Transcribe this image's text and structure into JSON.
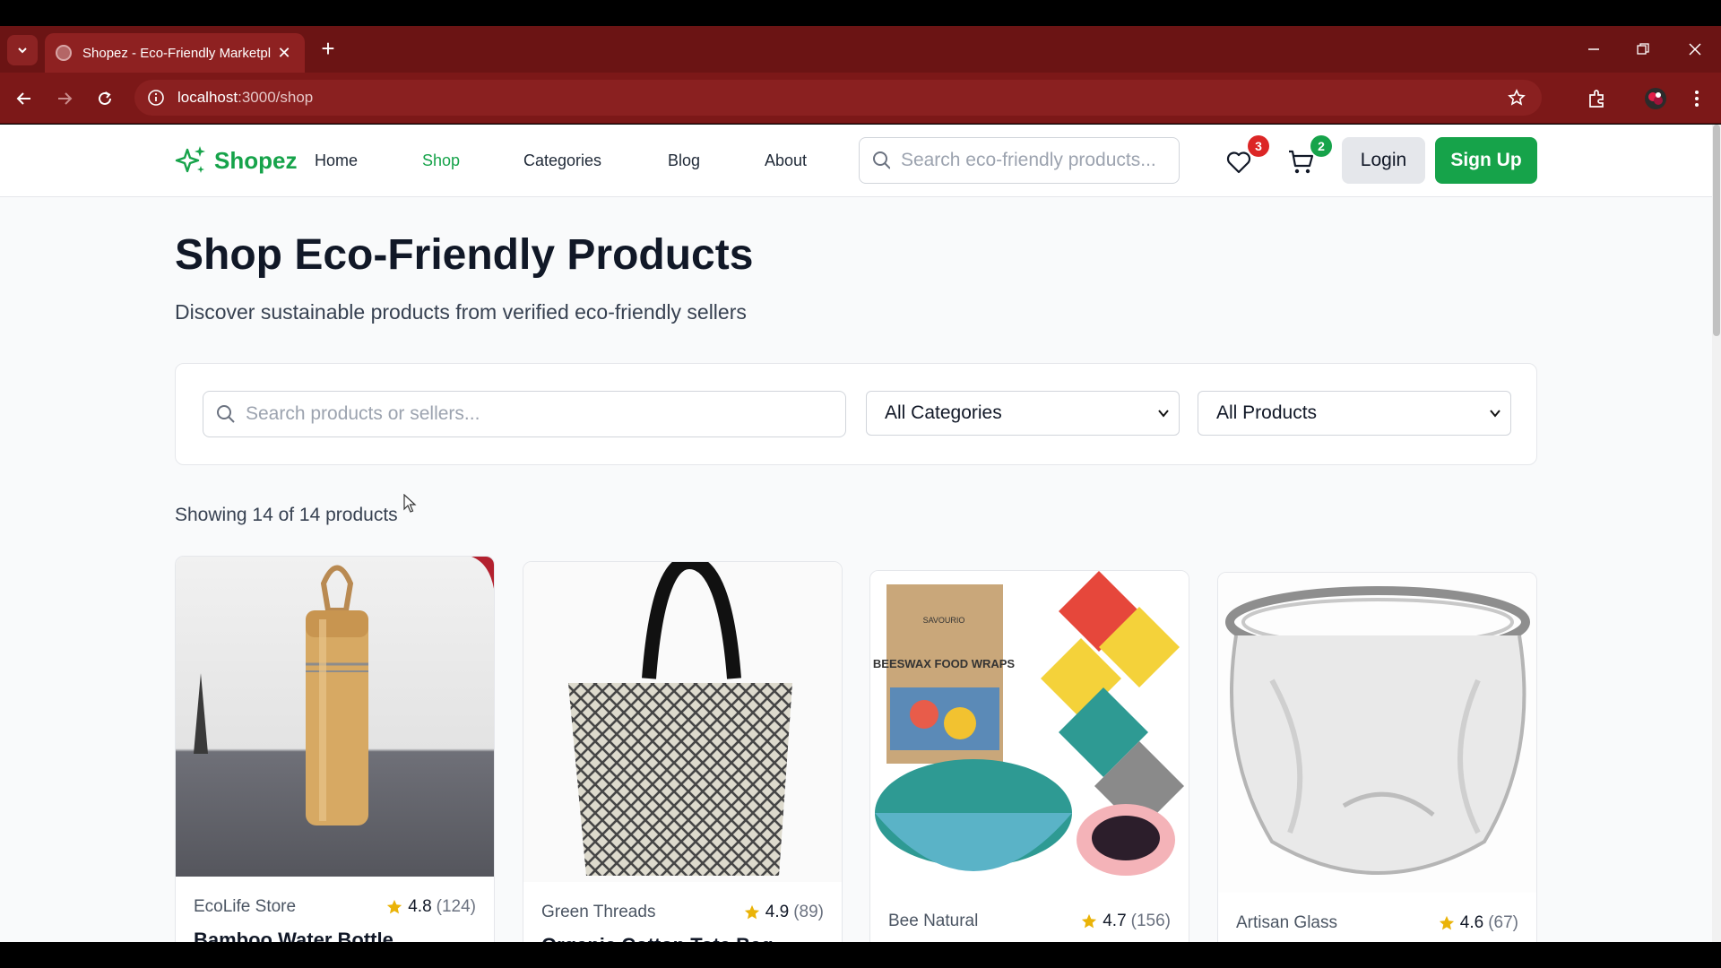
{
  "browser": {
    "tab_title": "Shopez - Eco-Friendly Marketpl",
    "url_host": "localhost",
    "url_path": ":3000/shop"
  },
  "site": {
    "logo_text": "Shopez",
    "nav": [
      "Home",
      "Shop",
      "Categories",
      "Blog",
      "About"
    ],
    "active_nav": "Shop",
    "header_search_placeholder": "Search eco-friendly products...",
    "wishlist_count": "3",
    "cart_count": "2",
    "login_label": "Login",
    "signup_label": "Sign Up",
    "brand_color": "#16a34a",
    "wishlist_badge_color": "#dc2626"
  },
  "main": {
    "title": "Shop Eco-Friendly Products",
    "subtitle": "Discover sustainable products from verified eco-friendly sellers",
    "filter_search_placeholder": "Search products or sellers...",
    "category_select": "All Categories",
    "product_select": "All Products",
    "result_count": "Showing 14 of 14 products"
  },
  "products": [
    {
      "seller": "EcoLife Store",
      "rating": "4.8",
      "reviews": "(124)",
      "name": "Bamboo Water Bottle"
    },
    {
      "seller": "Green Threads",
      "rating": "4.9",
      "reviews": "(89)",
      "name": "Organic Cotton Tote Bag"
    },
    {
      "seller": "Bee Natural",
      "rating": "4.7",
      "reviews": "(156)",
      "name": ""
    },
    {
      "seller": "Artisan Glass",
      "rating": "4.6",
      "reviews": "(67)",
      "name": ""
    }
  ],
  "product_images": {
    "p1": "BEESWAX FOOD WRAPS",
    "p1_brand": "SAVOURIO"
  }
}
